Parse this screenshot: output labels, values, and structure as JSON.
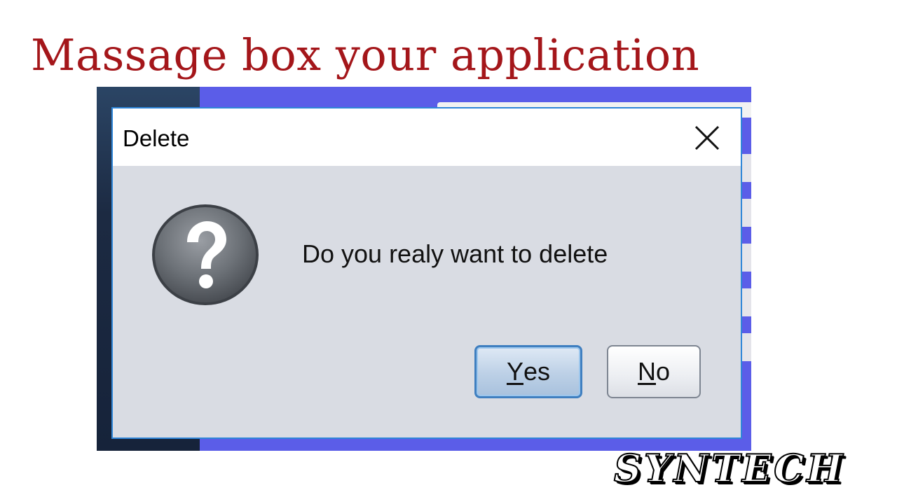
{
  "headline": "Massage box your application",
  "dialog": {
    "title": "Delete",
    "message": "Do you realy want to delete",
    "icon": "question-icon",
    "close_icon": "close-icon",
    "buttons": {
      "yes": {
        "mnemonic": "Y",
        "rest": "es"
      },
      "no": {
        "mnemonic": "N",
        "rest": "o"
      }
    }
  },
  "brand": "SYNTECH",
  "colors": {
    "headline": "#a4161a",
    "dialog_border": "#2f86d8",
    "dialog_body": "#d9dce3",
    "app_background": "#5b5de8"
  }
}
